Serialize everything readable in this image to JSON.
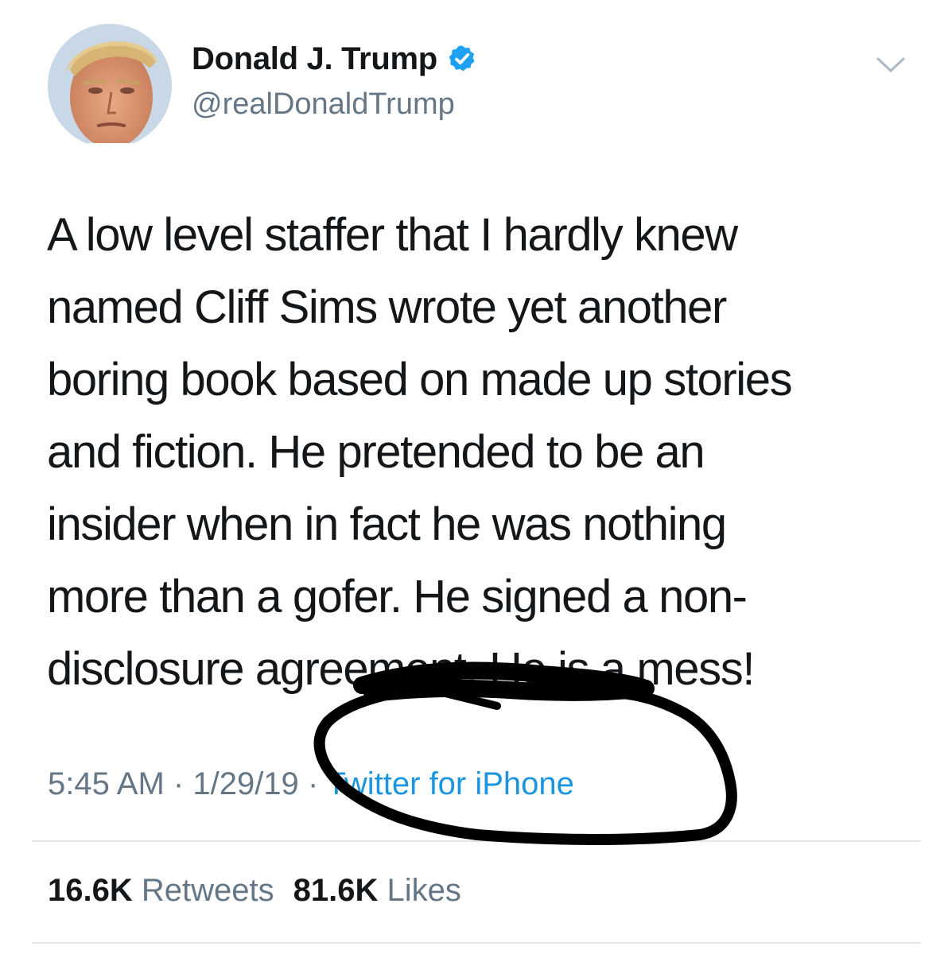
{
  "tweet": {
    "author": {
      "display_name": "Donald J. Trump",
      "handle": "@realDonaldTrump",
      "verified": true,
      "avatar_icon": "profile-photo"
    },
    "menu_icon": "chevron-down-icon",
    "text_lines": [
      "A low level staffer that I hardly knew",
      "named Cliff Sims wrote yet another",
      "boring book based on made up stories",
      "and fiction. He pretended to be an",
      "insider when in fact he was nothing",
      "more than a gofer. He signed a non-",
      "disclosure agreement. He is a mess!"
    ],
    "time": "5:45 AM",
    "separator": "·",
    "date": "1/29/19",
    "source": "Twitter for iPhone",
    "retweets": {
      "count": "16.6K",
      "label": "Retweets"
    },
    "likes": {
      "count": "81.6K",
      "label": "Likes"
    }
  },
  "colors": {
    "text": "#14171a",
    "secondary": "#657786",
    "link": "#1b95e0",
    "verified": "#1da1f2",
    "divider": "#e1e8ed",
    "marker": "#000000"
  }
}
